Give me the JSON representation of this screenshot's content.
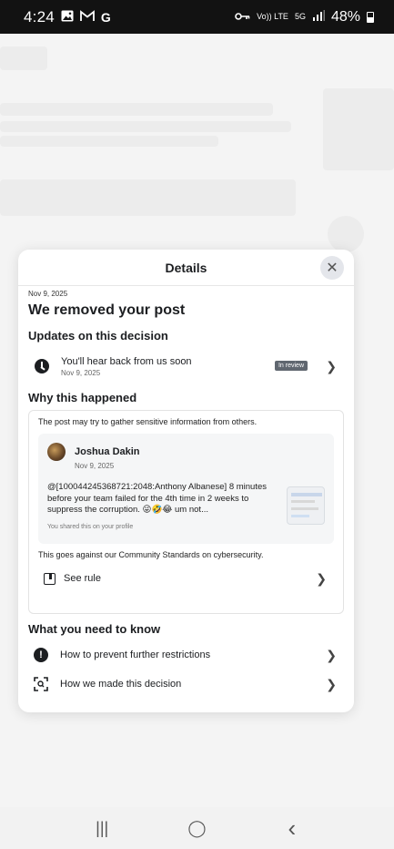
{
  "status_bar": {
    "time": "4:24",
    "left_icons": [
      "image-icon",
      "gmail-icon",
      "google-icon"
    ],
    "network_volte": "Vo)) LTE",
    "network_5g": "5G",
    "battery": "48%"
  },
  "modal": {
    "title": "Details",
    "date": "Nov 9, 2025",
    "headline": "We removed your post",
    "updates_title": "Updates on this decision",
    "update": {
      "text": "You'll hear back from us soon",
      "date": "Nov 9, 2025",
      "badge": "In review"
    },
    "why_title": "Why this happened",
    "why_text": "The post may try to gather sensitive information from others.",
    "post": {
      "author": "Joshua Dakin",
      "date": "Nov 9, 2025",
      "body": "@[100044245368721:2048:Anthony Albanese] 8 minutes before your team failed for the 4th time in 2 weeks to suppress the corruption. 😜🤣😂 um not...",
      "shared_note": "You shared this on your profile"
    },
    "goes_against": "This goes against our Community Standards on cybersecurity.",
    "see_rule": "See rule",
    "know_title": "What you need to know",
    "know_items": [
      {
        "label": "How to prevent further restrictions",
        "icon": "exclamation-icon"
      },
      {
        "label": "How we made this decision",
        "icon": "scan-search-icon"
      }
    ]
  },
  "nav": {
    "recents": "|||",
    "home": "◯",
    "back": "‹"
  }
}
